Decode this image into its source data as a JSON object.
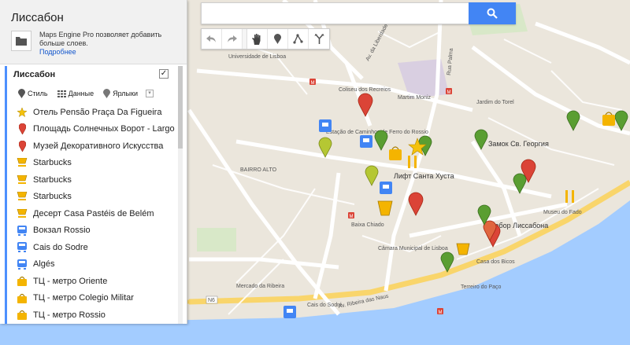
{
  "panel": {
    "map_title": "Лиссабон",
    "promo_text": "Maps Engine Pro позволяет добавить больше слоев.",
    "promo_link": "Подробнее",
    "layer_title": "Лиссабон",
    "layer_checked": "✓",
    "tools": {
      "style": "Стиль",
      "data": "Данные",
      "labels": "Ярлыки"
    },
    "features": [
      {
        "label": "Отель Pensão Praça Da Figueira",
        "icon": "star-icon",
        "color": "#f4c20d"
      },
      {
        "label": "Площадь Солнечных Ворот - Largo",
        "icon": "pin-icon",
        "color": "#db4437"
      },
      {
        "label": "Музей Декоративного Искусства",
        "icon": "pin-icon",
        "color": "#db4437"
      },
      {
        "label": "Starbucks",
        "icon": "coffee-icon",
        "color": "#f4b400"
      },
      {
        "label": "Starbucks",
        "icon": "coffee-icon",
        "color": "#f4b400"
      },
      {
        "label": "Starbucks",
        "icon": "coffee-icon",
        "color": "#f4b400"
      },
      {
        "label": "Десерт Casa Pastéis de Belém",
        "icon": "coffee-icon",
        "color": "#f4b400"
      },
      {
        "label": "Вокзал Rossio",
        "icon": "train-icon",
        "color": "#4285f4"
      },
      {
        "label": "Cais do Sodre",
        "icon": "train-icon",
        "color": "#4285f4"
      },
      {
        "label": "Algés",
        "icon": "train-icon",
        "color": "#4285f4"
      },
      {
        "label": "ТЦ - метро Oriente",
        "icon": "shopping-bag-icon",
        "color": "#f4b400"
      },
      {
        "label": "ТЦ - метро Colegio Militar",
        "icon": "shopping-bag-icon",
        "color": "#f4b400"
      },
      {
        "label": "ТЦ - метро Rossio",
        "icon": "shopping-bag-icon",
        "color": "#f4b400"
      }
    ]
  },
  "search": {
    "placeholder": "",
    "value": ""
  },
  "map": {
    "labels": {
      "liberdade": "Av. da Liberdade",
      "palma": "Rua Palma",
      "sao_jorge": "Замок Св. Георгия",
      "lift": "Лифт Санта Хуста",
      "bairro": "BAIRRO ALTO",
      "rossio": "Estação de Caminhos de Ferro do Rossio",
      "coliseu": "Coliseu dos Recreios",
      "se": "Собор Лиссабона",
      "chiado": "Baixa Chiado",
      "cais": "Cais do Sodré",
      "ribeira": "Mercado da Ribeira",
      "naus": "Av. Ribeira das Naus",
      "mouraria": "Martim Moniz",
      "torel": "Jardim do Torel",
      "comercio": "Terreiro do Paço",
      "universidade": "Universidade de Lisboa",
      "fado": "Museu do Fado",
      "camara": "Câmara Municipal de Lisboa",
      "bicos": "Casa dos Bicos",
      "n6": "N6"
    }
  }
}
